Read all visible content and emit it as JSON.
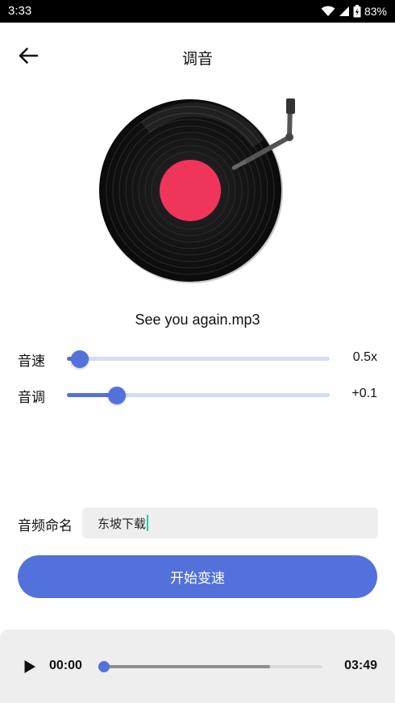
{
  "status_bar": {
    "time": "3:33",
    "battery_percent": "83%",
    "icons": [
      "wifi-icon",
      "cellular-signal-icon",
      "battery-icon"
    ]
  },
  "header": {
    "title": "调音",
    "back_icon": "arrow-left-icon"
  },
  "disc": {
    "label_color": "#f0355b",
    "record_color": "#111111"
  },
  "song": {
    "name": "See you again.mp3"
  },
  "sliders": [
    {
      "label": "音速",
      "value": "0.5x",
      "level": 0.05
    },
    {
      "label": "音调",
      "value": "+0.1",
      "level": 0.19
    }
  ],
  "naming": {
    "label": "音频命名",
    "input_value": "东坡下载"
  },
  "action": {
    "start_label": "开始变速"
  },
  "player": {
    "current_time": "00:00",
    "total_time": "03:49",
    "played_fraction": 0.0,
    "buffered_fraction": 0.76,
    "play_icon": "play-icon"
  },
  "colors": {
    "accent": "#5271db",
    "slider_track": "#d5dbf3",
    "cursor": "#20c9b0",
    "player_background": "#eeeeee"
  }
}
